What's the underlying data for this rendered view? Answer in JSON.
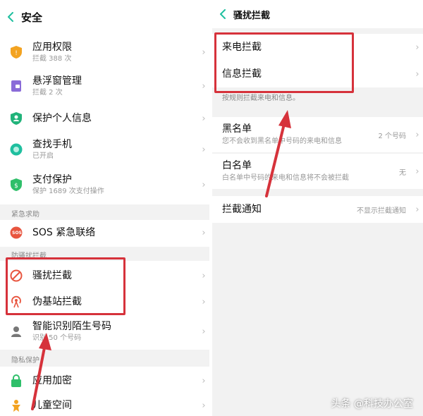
{
  "left": {
    "title": "安全",
    "items": [
      {
        "label": "应用权限",
        "sub": "拦截 388 次",
        "icon": "shield-icon",
        "color": "#f3a321"
      },
      {
        "label": "悬浮窗管理",
        "sub": "拦截 2 次",
        "icon": "floating-window-icon",
        "color": "#8a6bd8"
      },
      {
        "label": "保护个人信息",
        "sub": "",
        "icon": "person-shield-icon",
        "color": "#21b37a"
      },
      {
        "label": "查找手机",
        "sub": "已开启",
        "icon": "find-phone-icon",
        "color": "#1fbf9f"
      },
      {
        "label": "支付保护",
        "sub": "保护 1689 次支付操作",
        "icon": "payment-shield-icon",
        "color": "#2fbf6a"
      }
    ],
    "section_emergency": "紧急求助",
    "sos": {
      "label": "SOS 紧急联络",
      "icon": "sos-icon",
      "icon_text": "SOS",
      "color": "#e8553f"
    },
    "section_harass": "防骚扰拦截",
    "harass": {
      "label": "骚扰拦截",
      "icon": "block-icon",
      "color": "#e8553f"
    },
    "fake_station": {
      "label": "伪基站拦截",
      "icon": "antenna-icon",
      "color": "#e8553f"
    },
    "smart_id": {
      "label": "智能识别陌生号码",
      "sub": "识别 50 个号码",
      "icon": "user-icon",
      "color": "#777777"
    },
    "section_privacy": "隐私保护",
    "app_encrypt": {
      "label": "应用加密",
      "icon": "lock-icon",
      "color": "#2fbf6a"
    },
    "kids": {
      "label": "儿童空间",
      "icon": "child-icon",
      "color": "#f3a321"
    }
  },
  "right": {
    "title": "骚扰拦截",
    "call_block": "来电拦截",
    "msg_block": "信息拦截",
    "note": "按规则拦截来电和信息。",
    "blacklist": {
      "label": "黑名单",
      "sub": "您不会收到黑名单中号码的来电和信息",
      "value": "2 个号码"
    },
    "whitelist": {
      "label": "白名单",
      "sub": "白名单中号码的来电和信息将不会被拦截",
      "value": "无"
    },
    "notify": {
      "label": "拦截通知",
      "value": "不显示拦截通知"
    }
  },
  "chevron": "›",
  "watermark": "头条 @科技办公室",
  "colors": {
    "highlight": "#d6323b",
    "accent": "#1fbf9f",
    "section_bg": "#f2f2f2"
  }
}
